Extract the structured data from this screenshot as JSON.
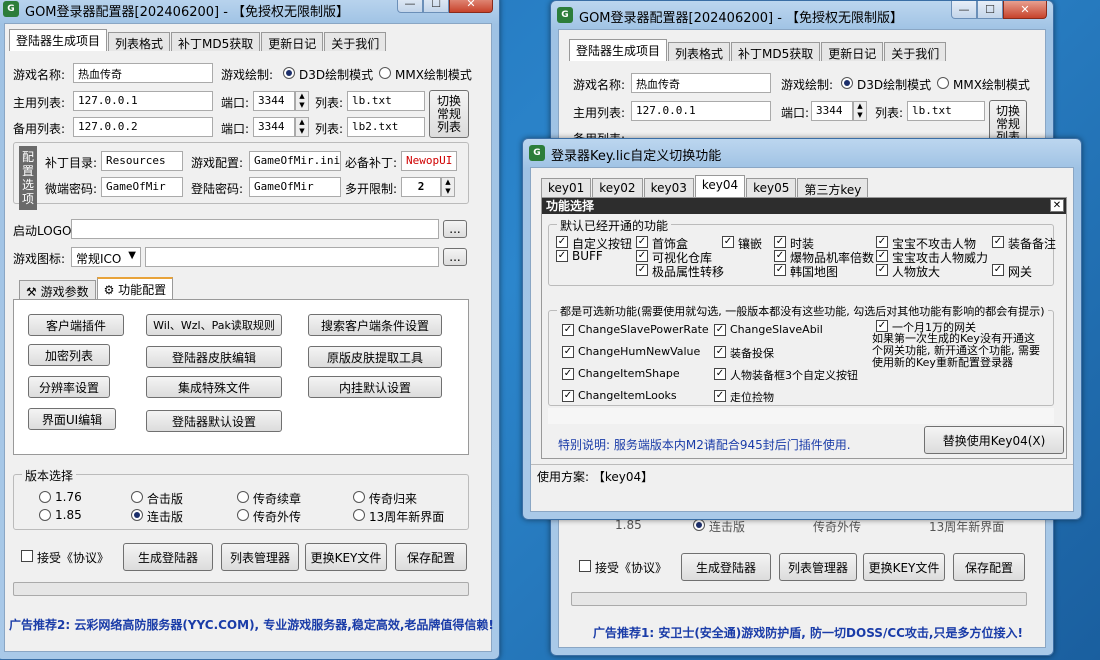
{
  "win1": {
    "title": "GOM登录器配置器[202406200] - 【免授权无限制版】",
    "tabs": [
      "登陆器生成项目",
      "列表格式",
      "补丁MD5获取",
      "更新日记",
      "关于我们"
    ],
    "game_name_label": "游戏名称:",
    "game_name": "热血传奇",
    "render_label": "游戏绘制:",
    "render_d3d": "D3D绘制模式",
    "render_mmx": "MMX绘制模式",
    "main_list_label": "主用列表:",
    "main_ip": "127.0.0.1",
    "port_label": "端口:",
    "main_port": "3344",
    "list_label": "列表:",
    "main_list_file": "lb.txt",
    "backup_list_label": "备用列表:",
    "backup_ip": "127.0.0.2",
    "backup_port": "3344",
    "backup_list_file": "lb2.txt",
    "switch_btn": "切换常规列表",
    "config_tag": "配置选项",
    "patch_dir_label": "补丁目录:",
    "patch_dir": "Resources",
    "game_config_label": "游戏配置:",
    "game_config": "GameOfMir.ini",
    "must_patch_label": "必备补丁:",
    "must_patch": "NewopUI",
    "micro_pwd_label": "微端密码:",
    "micro_pwd": "GameOfMir",
    "login_pwd_label": "登陆密码:",
    "login_pwd": "GameOfMir",
    "multi_label": "多开限制:",
    "multi_value": "2",
    "logo_label": "启动LOGO:",
    "icon_label": "游戏图标:",
    "icon_select": "常规ICO",
    "browse": "...",
    "subtabs": [
      "游戏参数",
      "功能配置"
    ],
    "func_buttons": [
      "客户端插件",
      "Wil、Wzl、Pak读取规则",
      "搜索客户端条件设置",
      "加密列表",
      "登陆器皮肤编辑",
      "原版皮肤提取工具",
      "分辨率设置",
      "集成特殊文件",
      "内挂默认设置",
      "界面UI编辑",
      "登陆器默认设置"
    ],
    "version_title": "版本选择",
    "versions": [
      "1.76",
      "合击版",
      "传奇续章",
      "传奇归来",
      "1.85",
      "连击版",
      "传奇外传",
      "13周年新界面"
    ],
    "accept": "接受《协议》",
    "bottom_buttons": [
      "生成登陆器",
      "列表管理器",
      "更换KEY文件",
      "保存配置"
    ],
    "ad": "广告推荐2: 云彩网络高防服务器(YYC.COM), 专业游戏服务器,稳定高效,老品牌值得信赖!"
  },
  "win2": {
    "title": "GOM登录器配置器[202406200] - 【免授权无限制版】",
    "tabs": [
      "登陆器生成项目",
      "列表格式",
      "补丁MD5获取",
      "更新日记",
      "关于我们"
    ],
    "game_name_label": "游戏名称:",
    "game_name": "热血传奇",
    "render_label": "游戏绘制:",
    "render_d3d": "D3D绘制模式",
    "render_mmx": "MMX绘制模式",
    "main_list_label": "主用列表:",
    "main_ip": "127.0.0.1",
    "port_label": "端口:",
    "main_port": "3344",
    "list_label": "列表:",
    "main_list_file": "lb.txt",
    "backup_list_label": "备用列表:",
    "switch_btn": "切换常规列表",
    "versions_partial": [
      "1.85",
      "连击版",
      "传奇外传",
      "13周年新界面"
    ],
    "accept": "接受《协议》",
    "bottom_buttons": [
      "生成登陆器",
      "列表管理器",
      "更换KEY文件",
      "保存配置"
    ],
    "ad": "广告推荐1: 安卫士(安全通)游戏防护盾, 防一切DOSS/CC攻击,只是多方位接入!"
  },
  "dialog": {
    "title": "登录器Key.lic自定义切换功能",
    "tabs": [
      "key01",
      "key02",
      "key03",
      "key04",
      "key05",
      "第三方key"
    ],
    "active_tab": 3,
    "inner_title": "功能选择",
    "default_title": "默认已经开通的功能",
    "default_items": [
      "自定义按钮",
      "首饰盒",
      "镶嵌",
      "时装",
      "宝宝不攻击人物",
      "装备备注",
      "BUFF",
      "可视化仓库",
      "爆物品机率倍数",
      "宝宝攻击人物威力",
      "极品属性转移",
      "韩国地图",
      "人物放大",
      "网关"
    ],
    "optional_title": "都是可选新功能(需要使用就勾选, 一般版本都没有这些功能, 勾选后对其他功能有影响的都会有提示)",
    "optional_left": [
      "ChangeSlavePowerRate",
      "ChangeHumNewValue",
      "ChangeItemShape",
      "ChangeItemLooks"
    ],
    "optional_mid": [
      "ChangeSlaveAbil",
      "装备投保",
      "人物装备框3个自定义按钮",
      "走位捡物"
    ],
    "optional_right_title": "一个月1万的网关",
    "optional_right_note": "如果第一次生成的Key没有开通这个网关功能, 新开通这个功能, 需要使用新的Key重新配置登录器",
    "note": "特别说明: 服务端版本内M2请配合945封后门插件使用.",
    "replace_btn": "替换使用Key04(X)",
    "scheme": "使用方案: 【key04】"
  }
}
